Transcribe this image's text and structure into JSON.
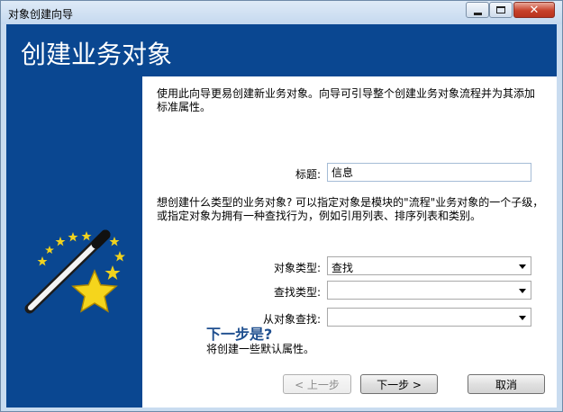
{
  "window": {
    "title": "对象创建向导",
    "close_glyph": "✕"
  },
  "header": {
    "title": "创建业务对象"
  },
  "intro": {
    "text": "使用此向导更易创建新业务对象。向导可引导整个创建业务对象流程并为其添加标准属性。"
  },
  "title_field": {
    "label": "标题:",
    "value": "信息"
  },
  "type_question": {
    "text": "想创建什么类型的业务对象? 可以指定对象是模块的\"流程\"业务对象的一个子级，或指定对象为拥有一种查找行为，例如引用列表、排序列表和类别。"
  },
  "object_type": {
    "label": "对象类型:",
    "value": "查找"
  },
  "lookup_type": {
    "label": "查找类型:",
    "value": ""
  },
  "lookup_from": {
    "label": "从对象查找:",
    "value": ""
  },
  "next_step": {
    "title": "下一步是?",
    "text": "将创建一些默认属性。"
  },
  "buttons": {
    "back": "< 上一步",
    "next": "下一步 >",
    "cancel": "取消"
  },
  "icons": {
    "wizard": "magic-wand-stars-icon"
  }
}
